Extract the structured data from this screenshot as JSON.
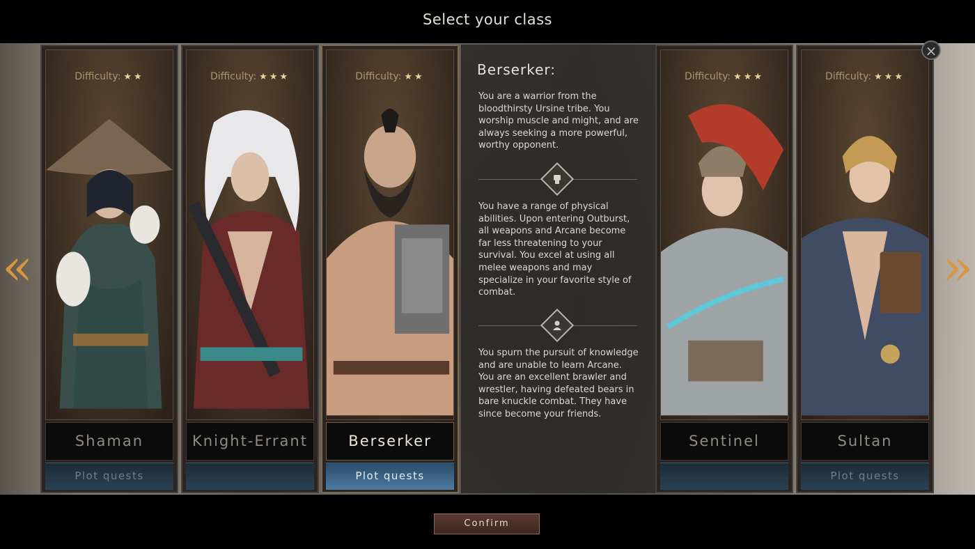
{
  "title": "Select your class",
  "difficulty_label": "Difficulty:",
  "classes": [
    {
      "name": "Shaman",
      "stars": "★★",
      "plot": "Plot quests",
      "selected": false
    },
    {
      "name": "Knight-Errant",
      "stars": "★★★",
      "plot": "",
      "selected": false
    },
    {
      "name": "Berserker",
      "stars": "★★",
      "plot": "Plot quests",
      "selected": true
    },
    {
      "name": "Sentinel",
      "stars": "★★★",
      "plot": "",
      "selected": false
    },
    {
      "name": "Sultan",
      "stars": "★★★",
      "plot": "Plot quests",
      "selected": false
    }
  ],
  "description": {
    "heading": "Berserker:",
    "para1": "You are a warrior from the bloodthirsty Ursine tribe. You worship muscle and might, and are always seeking a more powerful, worthy opponent.",
    "para2": "You have a range of physical abilities. Upon entering Outburst, all weapons and Arcane become far less threatening to your survival. You excel at using all melee weapons and may specialize in your favorite style of combat.",
    "para3": "You spurn the pursuit of knowledge and are unable to learn Arcane. You are an excellent brawler and wrestler, having defeated bears in bare knuckle combat. They have since become your friends.",
    "icon1": "fist-icon",
    "icon2": "person-icon"
  },
  "nav": {
    "left": "«",
    "right": "»",
    "close": "×"
  },
  "confirm_label": "Confirm"
}
